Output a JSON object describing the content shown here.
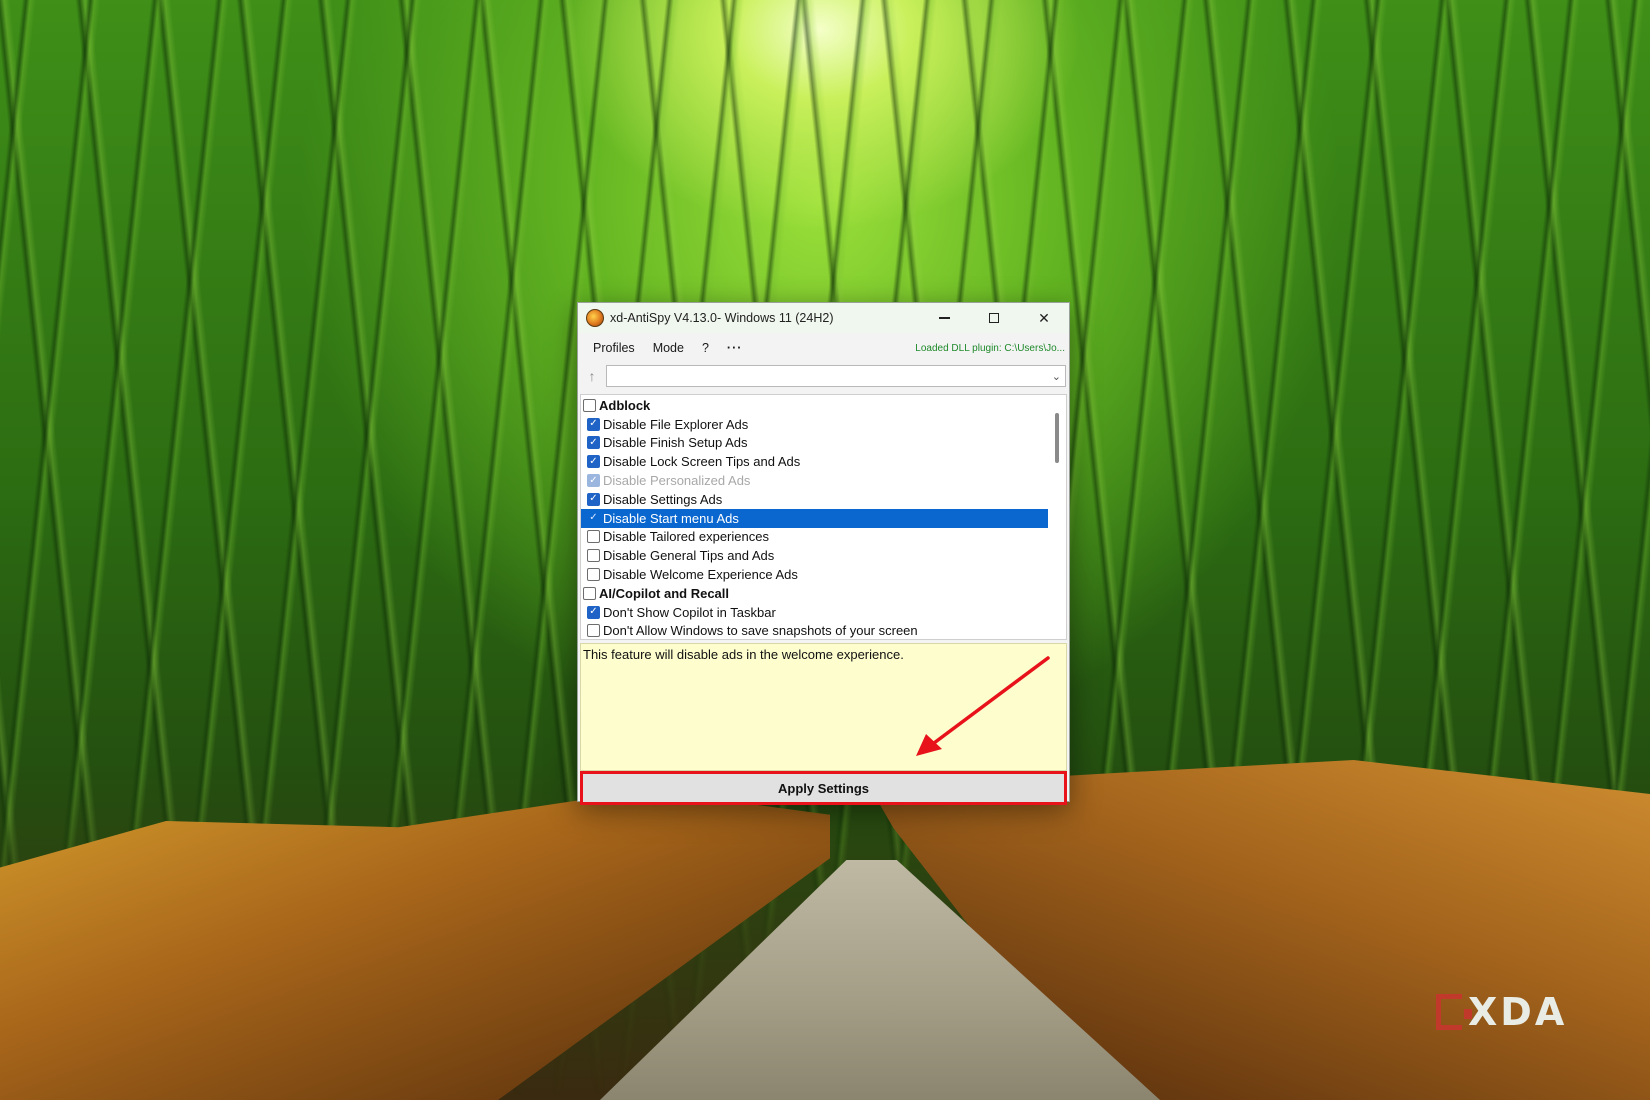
{
  "window": {
    "title": "xd-AntiSpy V4.13.0- Windows 11 (24H2)",
    "minimize_glyph": "",
    "close_glyph": "✕"
  },
  "menubar": {
    "items": [
      "Profiles",
      "Mode",
      "?",
      "···"
    ],
    "plugin_status": "Loaded DLL plugin: C:\\Users\\Jo..."
  },
  "nav": {
    "up_glyph": "↑",
    "search_value": "",
    "dropdown_glyph": "⌄"
  },
  "list": {
    "rows": [
      {
        "label": "Adblock",
        "type": "category",
        "checked": false
      },
      {
        "label": "Disable File Explorer Ads",
        "type": "item",
        "checked": true
      },
      {
        "label": "Disable Finish Setup Ads",
        "type": "item",
        "checked": true
      },
      {
        "label": "Disable Lock Screen Tips and Ads",
        "type": "item",
        "checked": true
      },
      {
        "label": "Disable Personalized Ads",
        "type": "item",
        "checked": true,
        "disabled": true
      },
      {
        "label": "Disable Settings Ads",
        "type": "item",
        "checked": true
      },
      {
        "label": "Disable Start menu Ads",
        "type": "item",
        "checked": true,
        "selected": true
      },
      {
        "label": "Disable Tailored experiences",
        "type": "item",
        "checked": false
      },
      {
        "label": "Disable General Tips and Ads",
        "type": "item",
        "checked": false
      },
      {
        "label": "Disable Welcome Experience Ads",
        "type": "item",
        "checked": false
      },
      {
        "label": "AI/Copilot and Recall",
        "type": "category",
        "checked": false
      },
      {
        "label": "Don't Show Copilot in Taskbar",
        "type": "item",
        "checked": true
      },
      {
        "label": "Don't Allow Windows to save snapshots of your screen",
        "type": "item",
        "checked": false
      }
    ]
  },
  "description": {
    "text": "This feature will disable ads in the welcome experience."
  },
  "apply_button": {
    "label": "Apply Settings"
  },
  "watermark": {
    "text": "XDA"
  },
  "colors": {
    "selection": "#0a67d0",
    "checkbox_checked": "#1f63c6",
    "description_bg": "#fdfdce",
    "annotation_red": "#e8121b",
    "plugin_status": "#1e8a2a"
  }
}
